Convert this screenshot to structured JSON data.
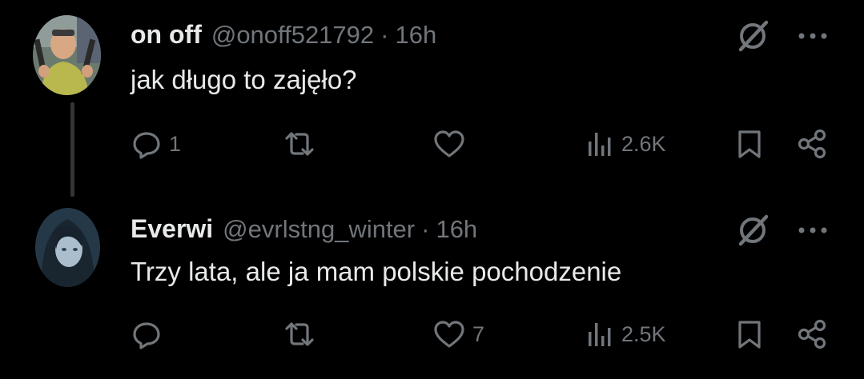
{
  "colors": {
    "background": "#000000",
    "primary_text": "#e7e9ea",
    "secondary_text": "#71767b",
    "thread_line": "#333639"
  },
  "tweets": [
    {
      "display_name": "on off",
      "handle": "@onoff521792",
      "separator": "·",
      "time": "16h",
      "text": "jak długo to zajęło?",
      "avatar_icon": "profile-photo",
      "actions": {
        "replies": "1",
        "retweets": "",
        "likes": "",
        "views": "2.6K"
      }
    },
    {
      "display_name": "Everwi",
      "handle": "@evrlstng_winter",
      "separator": "·",
      "time": "16h",
      "text": "Trzy lata, ale ja mam polskie pochodzenie",
      "avatar_icon": "profile-photo",
      "actions": {
        "replies": "",
        "retweets": "",
        "likes": "7",
        "views": "2.5K"
      }
    }
  ]
}
